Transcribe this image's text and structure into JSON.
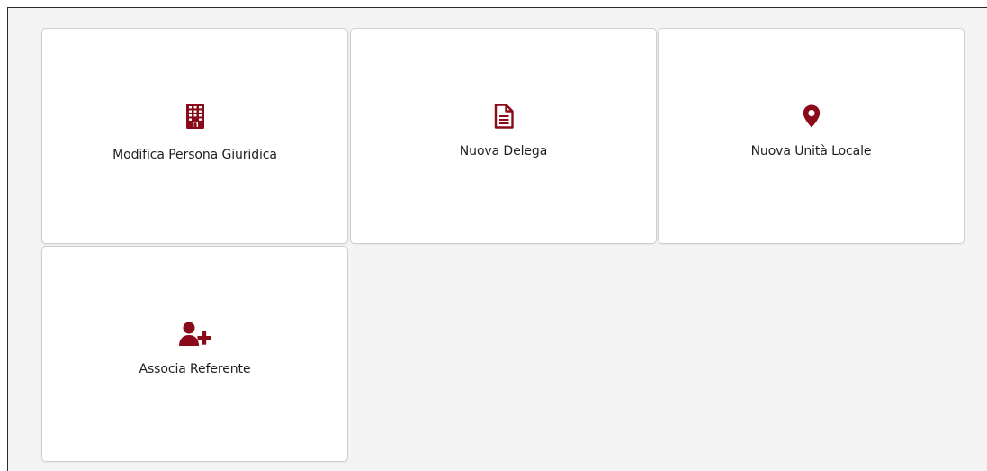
{
  "theme": {
    "accent": "#8b0a1a",
    "background": "#f4f4f4",
    "tile": "#ffffff"
  },
  "tiles": [
    {
      "label": "Modifica Persona Giuridica",
      "icon": "building-icon"
    },
    {
      "label": "Nuova Delega",
      "icon": "document-icon"
    },
    {
      "label": "Nuova Unità Locale",
      "icon": "map-pin-icon"
    },
    {
      "label": "Associa Referente",
      "icon": "user-plus-icon"
    }
  ]
}
